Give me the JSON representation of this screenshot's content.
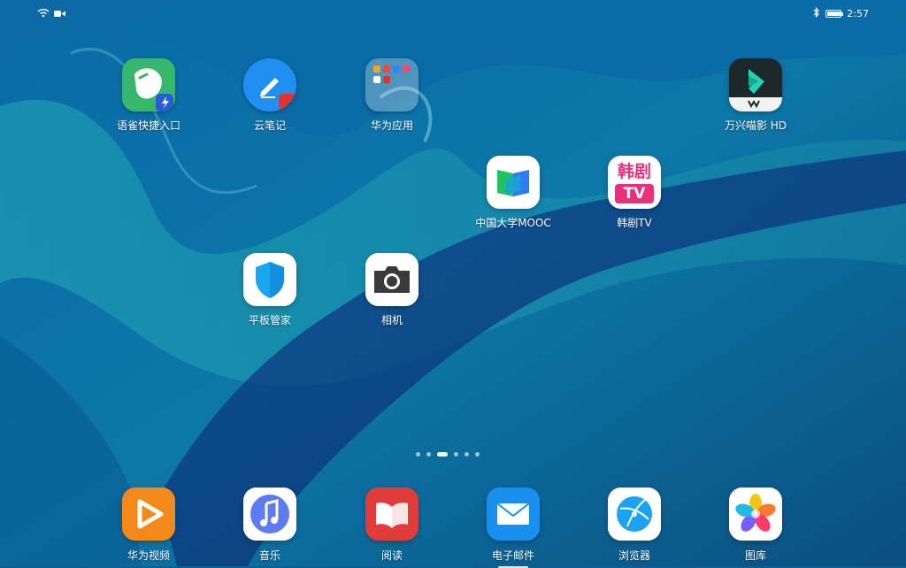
{
  "status": {
    "time": "2:57",
    "left_icons": [
      "wifi-icon",
      "camera-record-icon"
    ],
    "right_icons": [
      "bluetooth-icon",
      "battery-icon"
    ],
    "battery_level": 0.9
  },
  "apps": [
    {
      "label": "语雀快捷入口",
      "icon": "yuque-icon"
    },
    {
      "label": "云笔记",
      "icon": "cloud-note-icon"
    },
    {
      "label": "华为应用",
      "icon": "folder-icon"
    },
    {
      "label": "万兴喵影 HD",
      "icon": "filmora-icon"
    },
    {
      "label": "中国大学MOOC",
      "icon": "mooc-icon"
    },
    {
      "label": "韩剧TV",
      "icon": "hanju-tv-icon",
      "badge_top": "韩剧",
      "badge_bottom": "TV"
    },
    {
      "label": "平板管家",
      "icon": "shield-icon"
    },
    {
      "label": "相机",
      "icon": "camera-icon"
    }
  ],
  "dock": [
    {
      "label": "华为视频",
      "icon": "video-play-icon"
    },
    {
      "label": "音乐",
      "icon": "music-note-icon"
    },
    {
      "label": "阅读",
      "icon": "book-icon"
    },
    {
      "label": "电子邮件",
      "icon": "mail-icon"
    },
    {
      "label": "浏览器",
      "icon": "browser-icon"
    },
    {
      "label": "图库",
      "icon": "gallery-icon"
    }
  ],
  "pager": {
    "pages": 6,
    "current": 3
  },
  "colors": {
    "wallpaper_base": "#0b5f93",
    "accent": "#ffffff"
  }
}
